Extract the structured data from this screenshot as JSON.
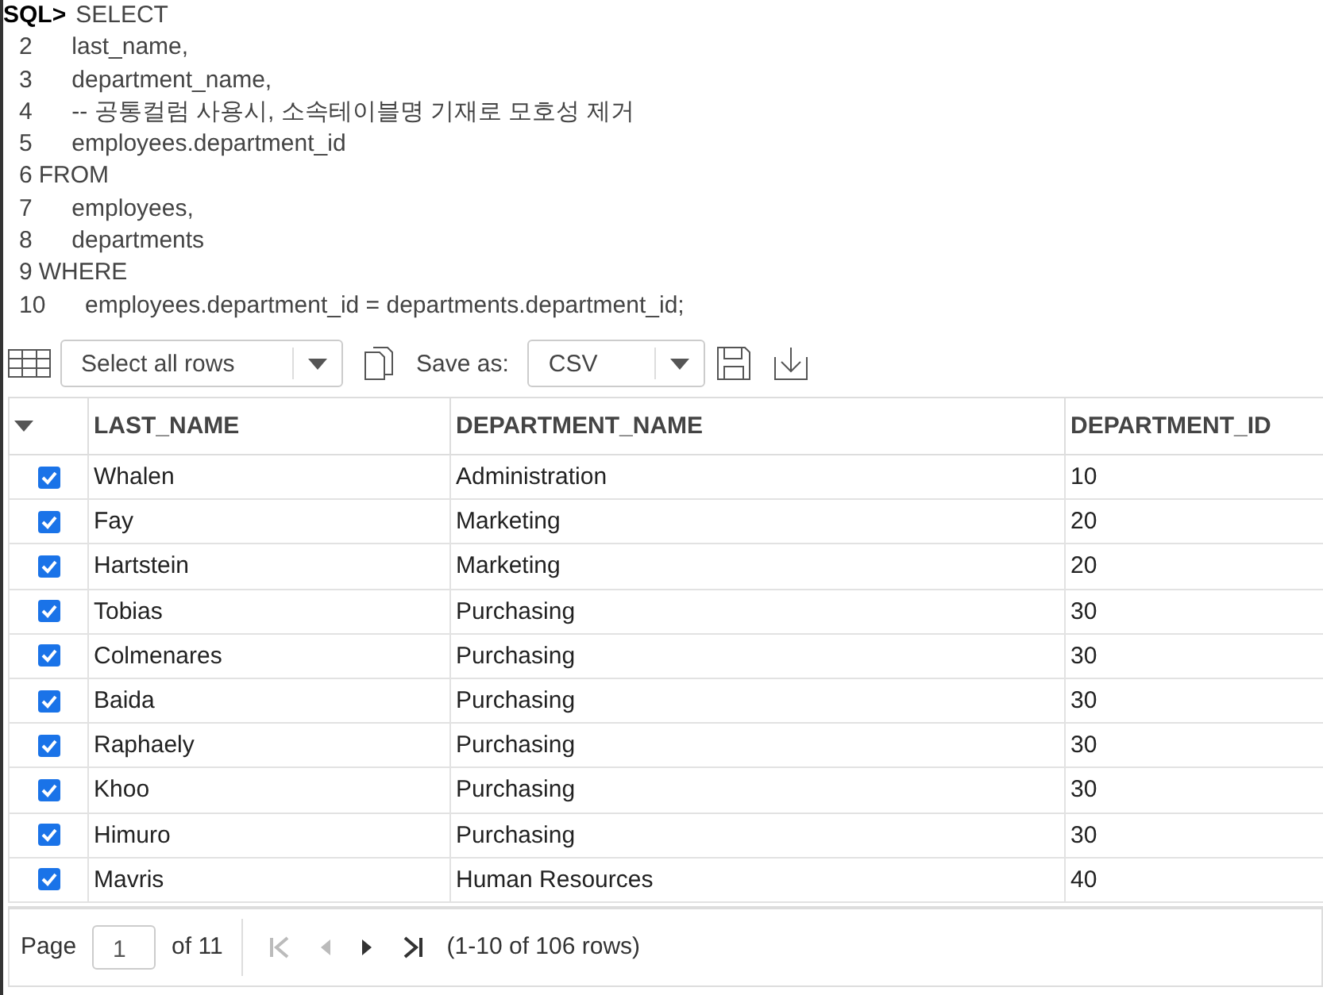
{
  "editor": {
    "prompt": "SQL>",
    "lines": [
      {
        "text": "SELECT"
      },
      {
        "number": "2",
        "text": "     last_name,"
      },
      {
        "number": "3",
        "text": "     department_name,"
      },
      {
        "number": "4",
        "text": "     -- 공통컬럼 사용시, 소속테이블명 기재로 모호성 제거"
      },
      {
        "number": "5",
        "text": "     employees.department_id"
      },
      {
        "number": "6",
        "text": "FROM"
      },
      {
        "number": "7",
        "text": "     employees,"
      },
      {
        "number": "8",
        "text": "     departments"
      },
      {
        "number": "9",
        "text": "WHERE"
      },
      {
        "number": "10",
        "text": "     employees.department_id = departments.department_id;"
      }
    ]
  },
  "toolbar": {
    "selection": "Select all rows",
    "save_label": "Save as:",
    "format": "CSV"
  },
  "table": {
    "columns": [
      "LAST_NAME",
      "DEPARTMENT_NAME",
      "DEPARTMENT_ID"
    ],
    "rows": [
      {
        "checked": true,
        "cells": [
          "Whalen",
          "Administration",
          "10"
        ]
      },
      {
        "checked": true,
        "cells": [
          "Fay",
          "Marketing",
          "20"
        ]
      },
      {
        "checked": true,
        "cells": [
          "Hartstein",
          "Marketing",
          "20"
        ]
      },
      {
        "checked": true,
        "cells": [
          "Tobias",
          "Purchasing",
          "30"
        ]
      },
      {
        "checked": true,
        "cells": [
          "Colmenares",
          "Purchasing",
          "30"
        ]
      },
      {
        "checked": true,
        "cells": [
          "Baida",
          "Purchasing",
          "30"
        ]
      },
      {
        "checked": true,
        "cells": [
          "Raphaely",
          "Purchasing",
          "30"
        ]
      },
      {
        "checked": true,
        "cells": [
          "Khoo",
          "Purchasing",
          "30"
        ]
      },
      {
        "checked": true,
        "cells": [
          "Himuro",
          "Purchasing",
          "30"
        ]
      },
      {
        "checked": true,
        "cells": [
          "Mavris",
          "Human Resources",
          "40"
        ]
      }
    ]
  },
  "pager": {
    "page_label": "Page",
    "page": "1",
    "of_label": "of 11",
    "nav": [
      {
        "kind": "first",
        "disabled": true
      },
      {
        "kind": "prev",
        "disabled": true
      },
      {
        "kind": "next",
        "disabled": false
      },
      {
        "kind": "last",
        "disabled": false
      }
    ],
    "summary": "(1-10 of 106 rows)"
  }
}
